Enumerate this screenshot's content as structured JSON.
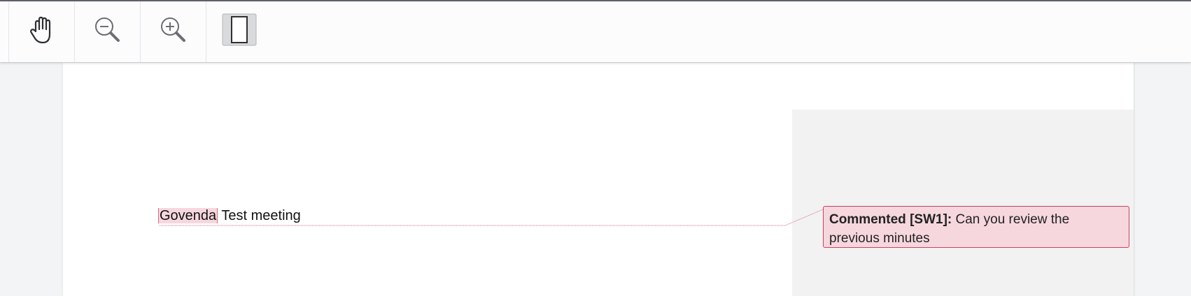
{
  "toolbar": {
    "tools": [
      {
        "name": "pan",
        "icon": "hand-icon"
      },
      {
        "name": "zoom-out",
        "icon": "zoom-out-icon"
      },
      {
        "name": "zoom-in",
        "icon": "zoom-in-icon"
      },
      {
        "name": "page-view",
        "icon": "single-page-icon"
      }
    ]
  },
  "document": {
    "highlighted_text": "Govenda",
    "rest_text": " Test meeting"
  },
  "comment": {
    "label": "Commented [SW1]:",
    "text": " Can you review the previous minutes"
  },
  "colors": {
    "highlight": "#f6d7de",
    "comment_border": "#c9425e",
    "margin_pane": "#f2f2f2"
  }
}
